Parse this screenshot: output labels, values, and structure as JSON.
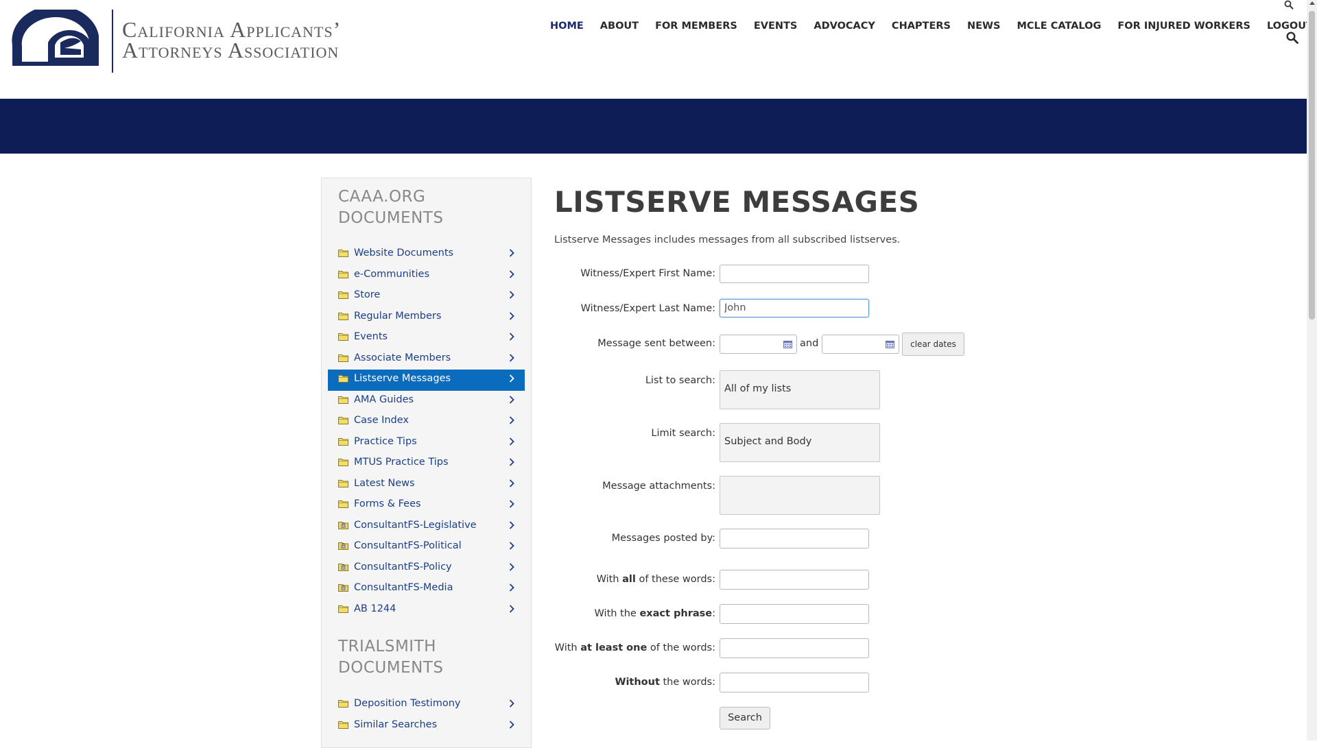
{
  "brand": {
    "line1": "California Applicants’",
    "line2": "Attorneys Association"
  },
  "nav": [
    "HOME",
    "ABOUT",
    "FOR MEMBERS",
    "EVENTS",
    "ADVOCACY",
    "CHAPTERS",
    "NEWS",
    "MCLE CATALOG",
    "FOR INJURED WORKERS",
    "LOGOUT"
  ],
  "sidebar": {
    "heading1_line1": "CAAA.ORG",
    "heading1_line2": "DOCUMENTS",
    "items": [
      {
        "label": "Website Documents",
        "icon": "folder-icon"
      },
      {
        "label": "e-Communities",
        "icon": "folder-icon"
      },
      {
        "label": "Store",
        "icon": "folder-icon"
      },
      {
        "label": "Regular Members",
        "icon": "folder-icon"
      },
      {
        "label": "Events",
        "icon": "folder-icon"
      },
      {
        "label": "Associate Members",
        "icon": "folder-icon"
      },
      {
        "label": "Listserve Messages",
        "icon": "folder-icon",
        "active": true
      },
      {
        "label": "AMA Guides",
        "icon": "folder-icon"
      },
      {
        "label": "Case Index",
        "icon": "folder-icon"
      },
      {
        "label": "Practice Tips",
        "icon": "folder-icon"
      },
      {
        "label": "MTUS Practice Tips",
        "icon": "folder-icon"
      },
      {
        "label": "Latest News",
        "icon": "folder-icon"
      },
      {
        "label": "Forms & Fees",
        "icon": "folder-icon"
      },
      {
        "label": "ConsultantFS-Legislative",
        "icon": "locked-folder-icon"
      },
      {
        "label": "ConsultantFS-Political",
        "icon": "locked-folder-icon"
      },
      {
        "label": "ConsultantFS-Policy",
        "icon": "locked-folder-icon"
      },
      {
        "label": "ConsultantFS-Media",
        "icon": "locked-folder-icon"
      },
      {
        "label": "AB 1244",
        "icon": "folder-icon"
      }
    ],
    "heading2_line1": "TRIALSMITH",
    "heading2_line2": "DOCUMENTS",
    "items2": [
      {
        "label": "Deposition Testimony",
        "icon": "folder-icon"
      },
      {
        "label": "Similar Searches",
        "icon": "folder-icon"
      }
    ]
  },
  "main": {
    "title": "LISTSERVE MESSAGES",
    "intro": "Listserve Messages includes messages from all subscribed listserves.",
    "labels": {
      "first_name": "Witness/Expert First Name:",
      "last_name": "Witness/Expert Last Name:",
      "sent_between": "Message sent between:",
      "and": "and",
      "list_to_search": "List to search:",
      "limit_search": "Limit search:",
      "attachments": "Message attachments:",
      "posted_by": "Messages posted by:",
      "all_pre": "With ",
      "all_bold": "all",
      "all_post": " of these words:",
      "exact_pre": "With the ",
      "exact_bold": "exact phrase",
      "exact_post": ":",
      "atleast_pre": "With ",
      "atleast_bold": "at least one",
      "atleast_post": " of the words:",
      "without_bold": "Without",
      "without_post": " the words:"
    },
    "values": {
      "first_name": "",
      "last_name": "John",
      "date_from": "",
      "date_to": "",
      "list_to_search": "All of my lists",
      "limit_search": "Subject and Body",
      "attachments": "",
      "posted_by": "",
      "all_words": "",
      "exact_phrase": "",
      "at_least_one": "",
      "without_words": ""
    },
    "clear_dates": "clear dates",
    "search_button": "Search"
  },
  "colors": {
    "banner": "#0f1d56",
    "active_item": "#0b6bbd",
    "link": "#1b3f86",
    "nav_active": "#1b2a6b"
  }
}
